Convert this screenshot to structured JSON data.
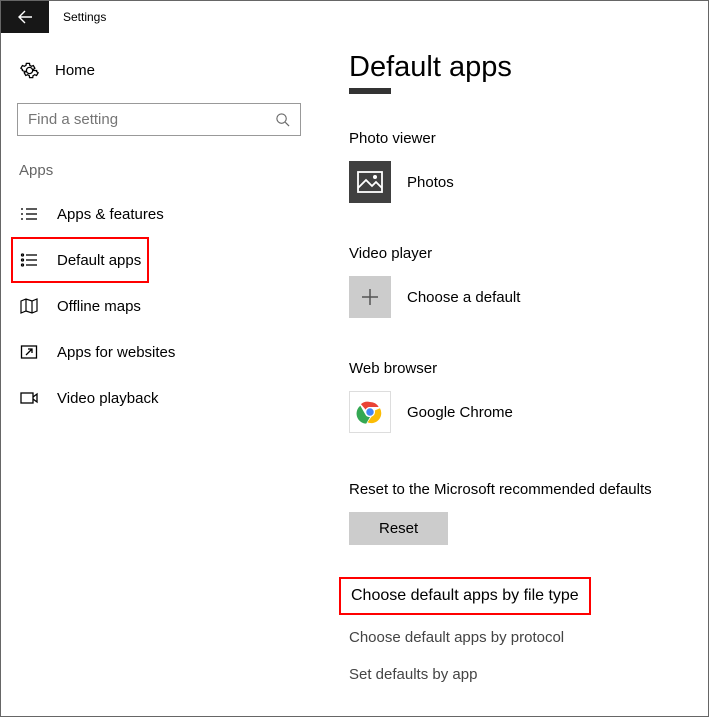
{
  "titlebar": {
    "title": "Settings"
  },
  "sidebar": {
    "home": "Home",
    "search_placeholder": "Find a setting",
    "category": "Apps",
    "items": [
      {
        "label": "Apps & features"
      },
      {
        "label": "Default apps"
      },
      {
        "label": "Offline maps"
      },
      {
        "label": "Apps for websites"
      },
      {
        "label": "Video playback"
      }
    ]
  },
  "main": {
    "title": "Default apps",
    "sections": {
      "photo_viewer": {
        "label": "Photo viewer",
        "app": "Photos"
      },
      "video_player": {
        "label": "Video player",
        "app": "Choose a default"
      },
      "web_browser": {
        "label": "Web browser",
        "app": "Google Chrome"
      }
    },
    "reset": {
      "text": "Reset to the Microsoft recommended defaults",
      "button": "Reset"
    },
    "links": [
      "Choose default apps by file type",
      "Choose default apps by protocol",
      "Set defaults by app"
    ]
  }
}
